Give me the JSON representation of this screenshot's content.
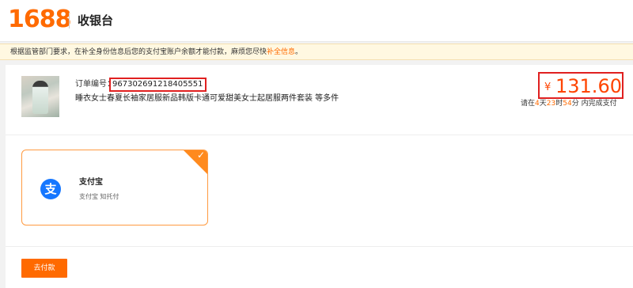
{
  "header": {
    "logo_text": "1688",
    "title": "收银台"
  },
  "notice": {
    "text": "根据监管部门要求，在补全身份信息后您的支付宝账户余额才能付款，麻烦您尽快",
    "link_label": "补全信息",
    "suffix": "。"
  },
  "order": {
    "number_label": "订单编号：",
    "number": "967302691218405551",
    "product_title": "睡衣女士春夏长袖家居服新品韩版卡通可爱甜美女士起居服两件套装  等多件",
    "currency_symbol": "¥",
    "amount": "131.60",
    "deadline_prefix": "请在",
    "deadline_days": "4",
    "deadline_days_unit": "天",
    "deadline_hours": "23",
    "deadline_hours_unit": "时",
    "deadline_minutes": "54",
    "deadline_minutes_unit": "分",
    "deadline_suffix": " 内完成支付"
  },
  "payment": {
    "method_name": "支付宝",
    "method_desc": "支付宝 知托付",
    "selected": true
  },
  "actions": {
    "pay_label": "去付款"
  },
  "colors": {
    "accent": "#ff6a00",
    "price": "#ff4400",
    "highlight_border": "#e02020",
    "alipay_blue": "#1677ff",
    "notice_bg": "#fff8e1"
  },
  "icons": {
    "payment_icon": "alipay-icon",
    "check_icon": "check-icon"
  }
}
